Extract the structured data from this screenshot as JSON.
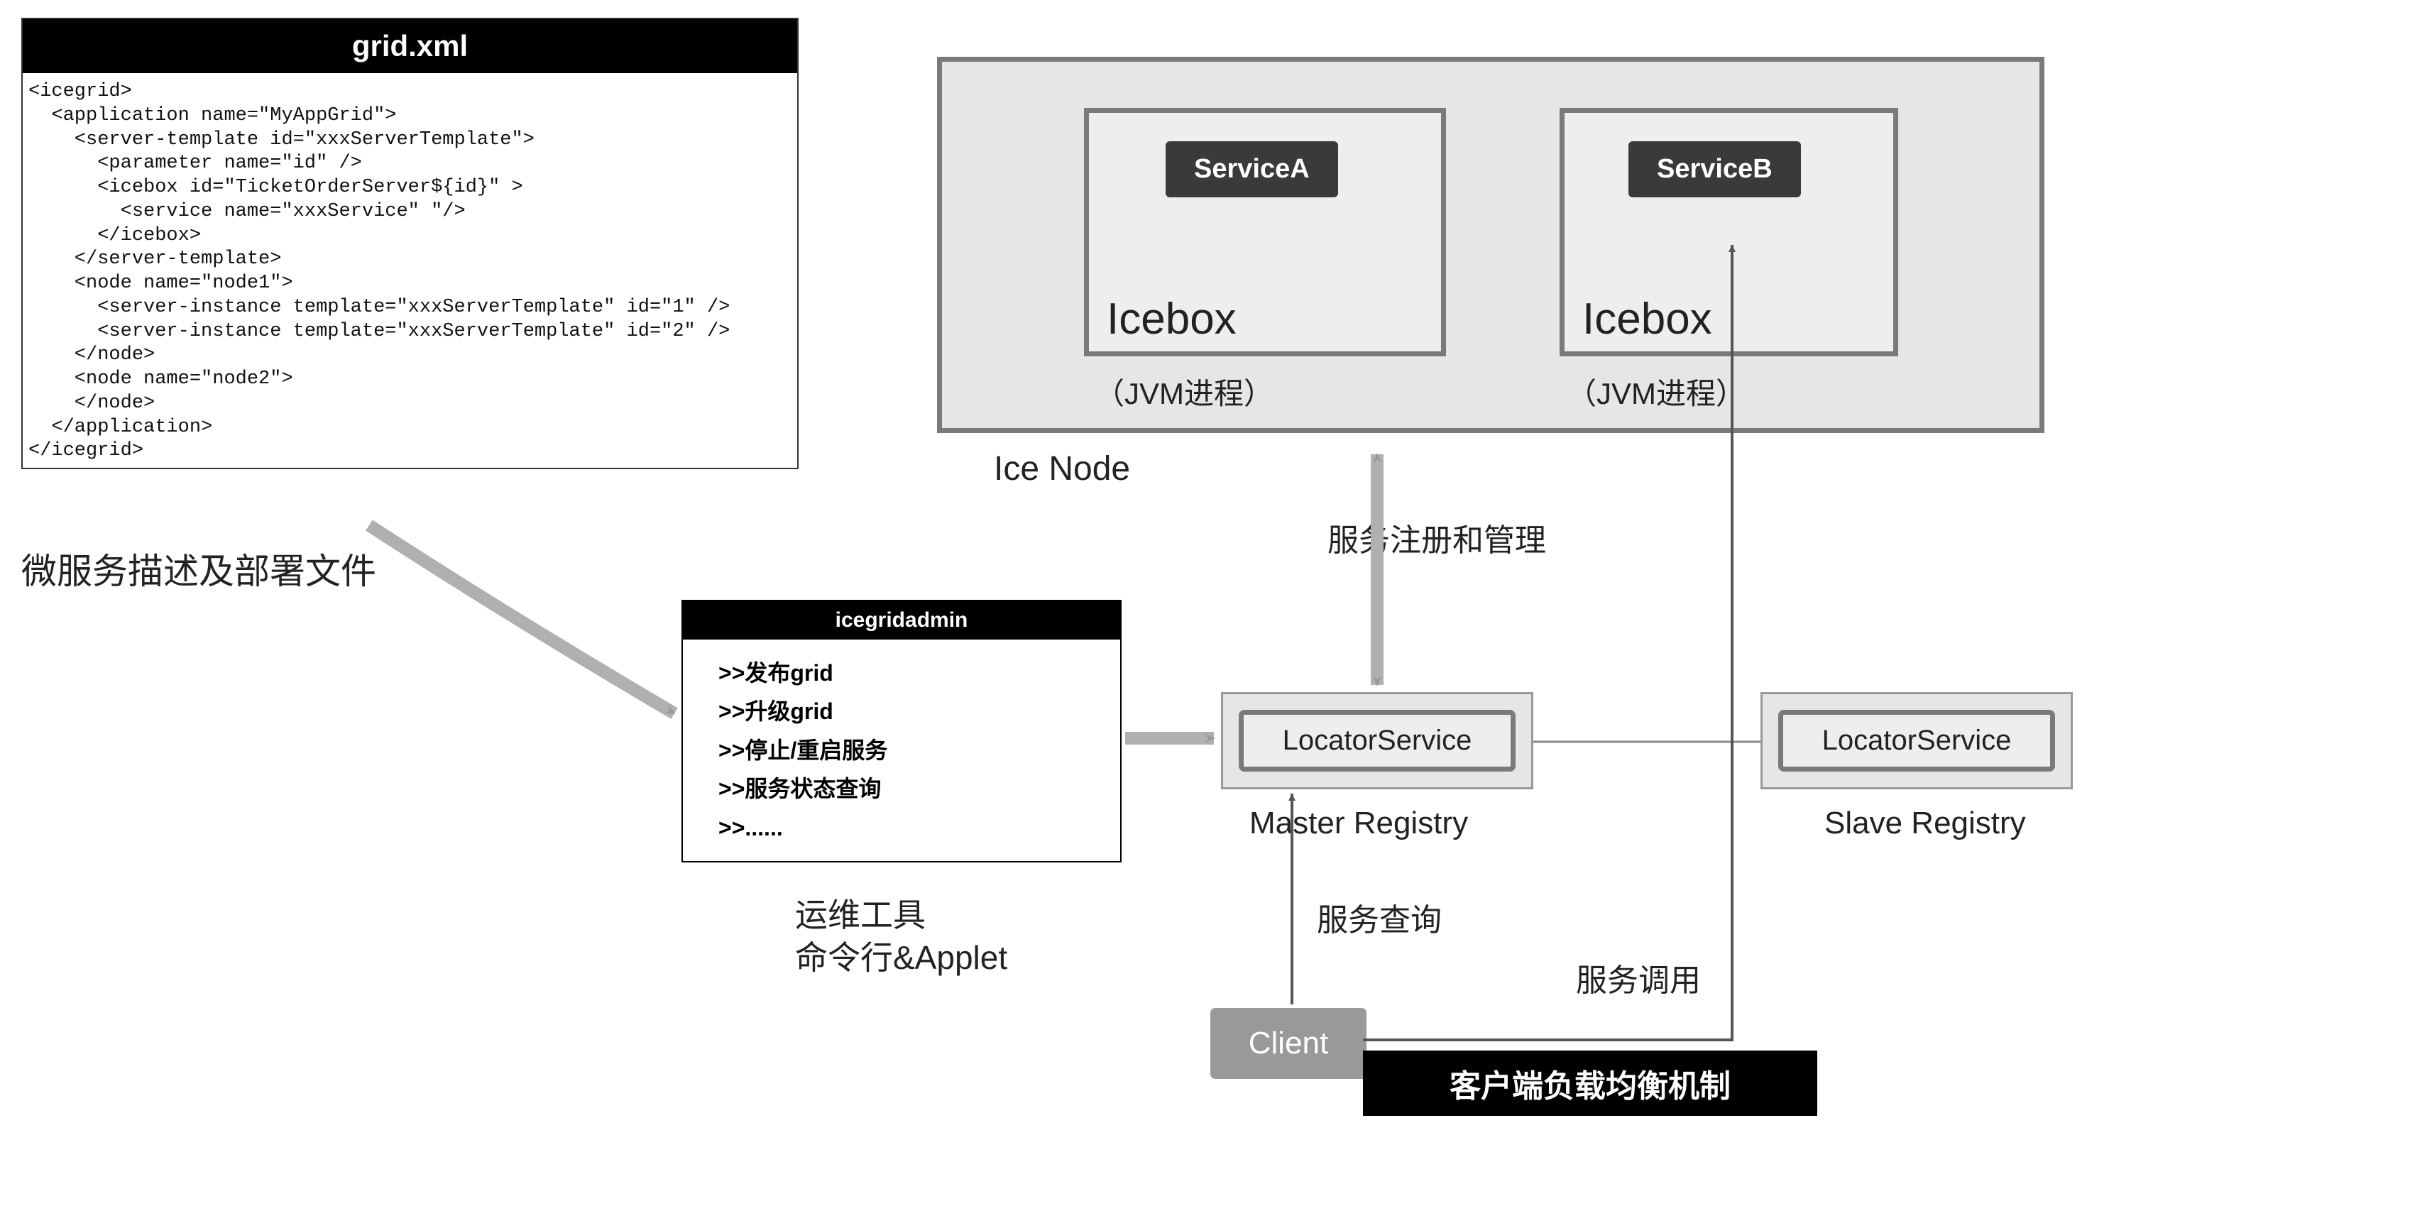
{
  "grid_xml": {
    "title": "grid.xml",
    "code": "<icegrid>\n  <application name=\"MyAppGrid\">\n    <server-template id=\"xxxServerTemplate\">\n      <parameter name=\"id\" />\n      <icebox id=\"TicketOrderServer${id}\" >\n        <service name=\"xxxService\" \"/>\n      </icebox>\n    </server-template>\n    <node name=\"node1\">\n      <server-instance template=\"xxxServerTemplate\" id=\"1\" />\n      <server-instance template=\"xxxServerTemplate\" id=\"2\" />\n    </node>\n    <node name=\"node2\">\n    </node>\n  </application>\n</icegrid>"
  },
  "microservice_label": "微服务描述及部署文件",
  "admin": {
    "title": "icegridadmin",
    "items": [
      ">>发布grid",
      ">>升级grid",
      ">>停止/重启服务",
      ">>服务状态查询",
      ">>......"
    ],
    "caption_line1": "运维工具",
    "caption_line2": "命令行&Applet"
  },
  "ice_node": {
    "label": "Ice Node",
    "icebox1": {
      "title": "Icebox",
      "service": "ServiceA",
      "jvm": "（JVM进程）"
    },
    "icebox2": {
      "title": "Icebox",
      "service": "ServiceB",
      "jvm": "（JVM进程）"
    }
  },
  "registry": {
    "locator": "LocatorService",
    "master": "Master Registry",
    "slave": "Slave Registry"
  },
  "client": "Client",
  "black_bar": "客户端负载均衡机制",
  "annotations": {
    "register": "服务注册和管理",
    "query": "服务查询",
    "invoke": "服务调用"
  }
}
